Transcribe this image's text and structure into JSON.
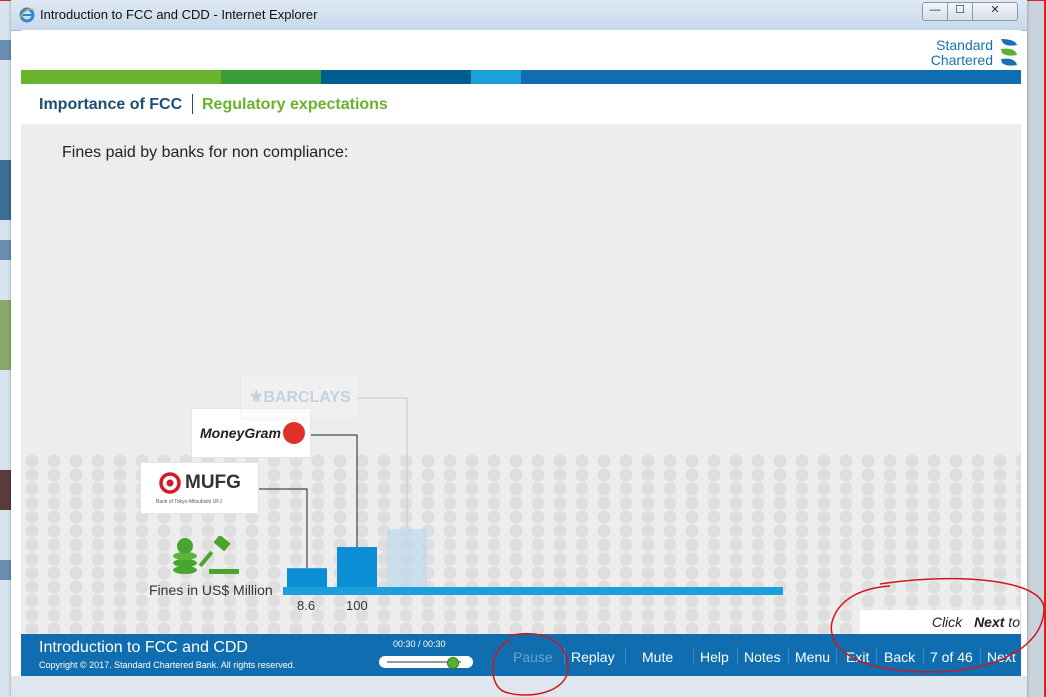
{
  "window": {
    "title": "Introduction to FCC and CDD - Internet Explorer",
    "buttons": {
      "minimize": "—",
      "maximize": "☐",
      "close": "✕"
    }
  },
  "brand": {
    "logo_line1": "Standard",
    "logo_line2": "Chartered",
    "colors": [
      "#6ab42d",
      "#3b9b37",
      "#005d8f",
      "#1ba0dc",
      "#0f6db0"
    ]
  },
  "nav": {
    "section": "Importance of FCC",
    "topic": "Regulatory expectations"
  },
  "content": {
    "intro": "Fines paid by banks for non compliance:",
    "fines_label": "Fines in US$ Million",
    "click_next_prefix": "Click ",
    "click_next_bold": "Next",
    "click_next_suffix": " to continue."
  },
  "chart_data": {
    "type": "bar",
    "categories": [
      "MUFG",
      "MoneyGram",
      "Barclays"
    ],
    "values": [
      8.6,
      100,
      null
    ],
    "value_labels": [
      "8.6",
      "100",
      ""
    ],
    "ylabel": "Fines in US$ Million",
    "logos": {
      "mufg": "MUFG",
      "mufg_sub": "Bank of Tokyo-Mitsubishi UFJ",
      "moneygram": "MoneyGram",
      "barclays": "BARCLAYS"
    }
  },
  "footer": {
    "course_title": "Introduction to FCC and CDD",
    "copyright": "Copyright © 2017. Standard Chartered Bank. All rights reserved.",
    "time": "00:30 / 00:30",
    "progress_fraction": 1.0,
    "controls": {
      "pause": "Pause",
      "replay": "Replay",
      "mute": "Mute",
      "help": "Help",
      "notes": "Notes",
      "menu": "Menu",
      "exit": "Exit",
      "back": "Back",
      "page": "7 of 46",
      "next": "Next"
    }
  }
}
